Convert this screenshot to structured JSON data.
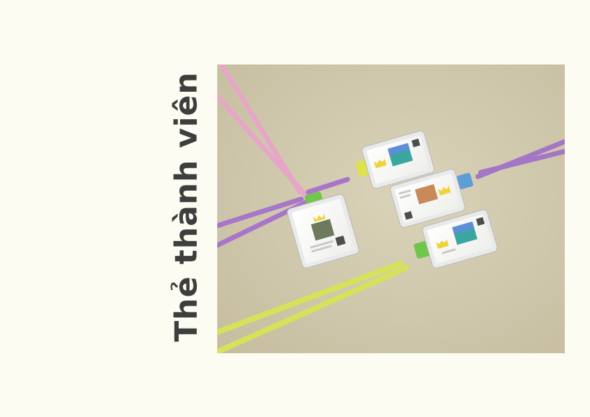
{
  "title": "Thẻ thành viên",
  "colors": {
    "page_background": "#fdfcf3",
    "title_color": "#3e3e3e",
    "backdrop": "#d4ccb1",
    "lanyard_pink": "#e9a7c9",
    "lanyard_purple": "#a677c9",
    "lanyard_lime": "#d7e35a",
    "clip_green": "#6fc64a",
    "clip_yellow": "#dfe24a",
    "clip_blue": "#5d9ed6",
    "card_accent": "#f2d23a"
  },
  "photo": {
    "description_icon": "lanyard-id-cards-photo",
    "cards": [
      {
        "id": "card-green-clip",
        "clip_color": "clip_green"
      },
      {
        "id": "card-yellow-clip",
        "clip_color": "clip_yellow"
      },
      {
        "id": "card-blue-clip",
        "clip_color": "clip_blue"
      },
      {
        "id": "card-lime-clip",
        "clip_color": "clip_green"
      }
    ]
  }
}
